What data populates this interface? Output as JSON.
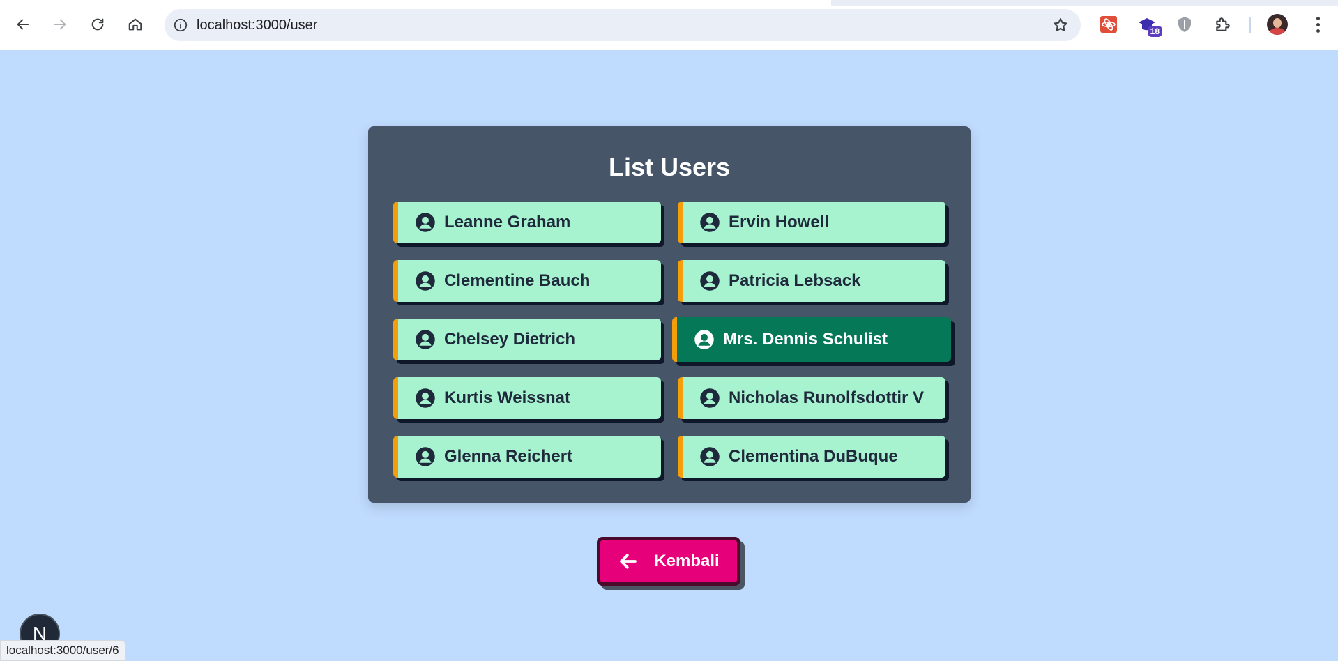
{
  "browser": {
    "url": "localhost:3000/user",
    "extension_badge": "18"
  },
  "page": {
    "title": "List Users",
    "users": [
      {
        "name": "Leanne Graham"
      },
      {
        "name": "Ervin Howell"
      },
      {
        "name": "Clementine Bauch"
      },
      {
        "name": "Patricia Lebsack"
      },
      {
        "name": "Chelsey Dietrich"
      },
      {
        "name": "Mrs. Dennis Schulist"
      },
      {
        "name": "Kurtis Weissnat"
      },
      {
        "name": "Nicholas Runolfsdottir V"
      },
      {
        "name": "Glenna Reichert"
      },
      {
        "name": "Clementina DuBuque"
      }
    ],
    "back_label": "Kembali"
  },
  "dev_indicator": "N",
  "status_url": "localhost:3000/user/6",
  "colors": {
    "page_bg": "#bfdbfe",
    "card_bg": "#475569",
    "user_btn_bg": "#a7f3d0",
    "user_btn_active_bg": "#047857",
    "accent_border": "#f59e0b",
    "back_btn_bg": "#e6007a"
  }
}
